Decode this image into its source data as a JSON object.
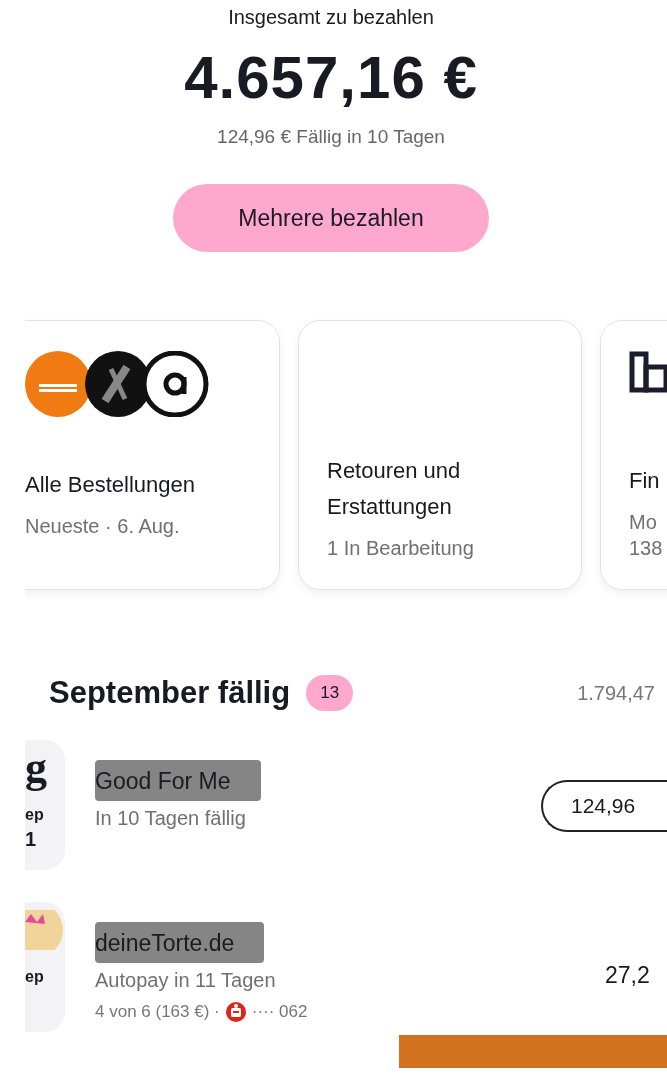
{
  "summary": {
    "label": "Insgesamt zu bezahlen",
    "total": "4.657,16 €",
    "next_due": "124,96 € Fällig in 10 Tagen",
    "button": "Mehrere bezahlen"
  },
  "cards": [
    {
      "kind": "logos",
      "title": "Alle Bestellungen",
      "subtitle": "Neueste · 6. Aug."
    },
    {
      "kind": "blank",
      "title": "Retouren und Erstattungen",
      "subtitle": "1 In Bearbeitung"
    },
    {
      "kind": "building",
      "title": "Fin",
      "subtitle": "Mo",
      "subtitle_2": "138"
    }
  ],
  "section": {
    "title": "September fällig",
    "count": "13",
    "total": "1.794,47"
  },
  "payments": [
    {
      "kind": "pill",
      "logo_text": "g",
      "date_month": "ep",
      "date_day": "1",
      "name": "Good For Me",
      "status": "In 10 Tagen fällig",
      "amount": "124,96"
    },
    {
      "kind": "autopay",
      "date_month": "ep",
      "name": "deineTorte.de",
      "status": "Autopay in 11 Tagen",
      "plan": "4 von 6 (163 €) ·",
      "account": "···· 062",
      "amount": "27,2"
    }
  ]
}
